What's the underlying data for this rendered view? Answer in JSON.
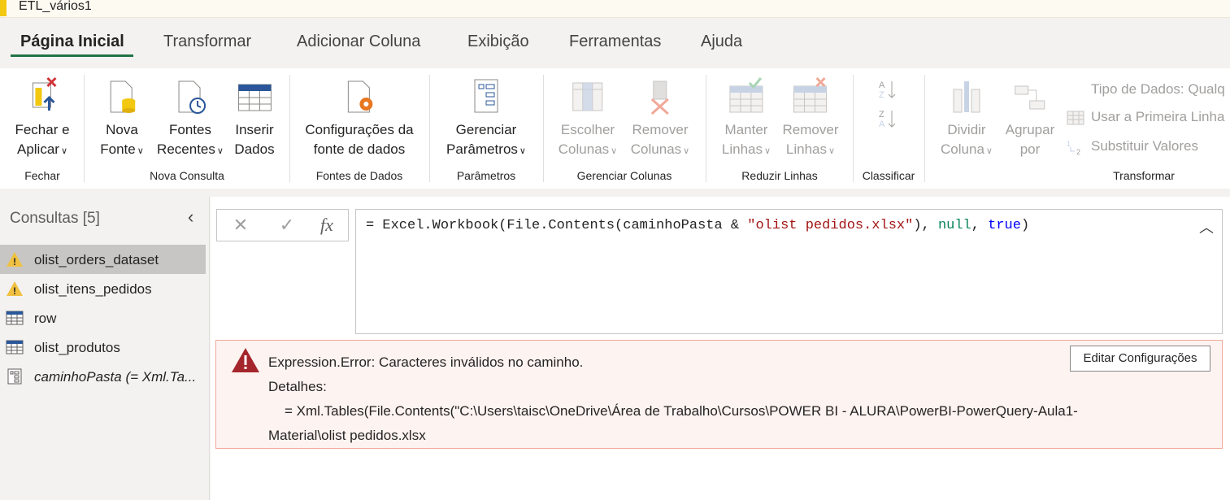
{
  "window": {
    "title": "ETL_vários1"
  },
  "tabs": [
    {
      "label": "Página Inicial",
      "active": true
    },
    {
      "label": "Transformar"
    },
    {
      "label": "Adicionar Coluna"
    },
    {
      "label": "Exibição"
    },
    {
      "label": "Ferramentas"
    },
    {
      "label": "Ajuda"
    }
  ],
  "ribbon": {
    "buttons": {
      "fechar": {
        "l1": "Fechar e",
        "l2": "Aplicar"
      },
      "nova_fonte": {
        "l1": "Nova",
        "l2": "Fonte"
      },
      "fontes_recentes": {
        "l1": "Fontes",
        "l2": "Recentes"
      },
      "inserir_dados": {
        "l1": "Inserir",
        "l2": "Dados"
      },
      "config_fonte": {
        "l1": "Configurações da",
        "l2": "fonte de dados"
      },
      "gerenciar_param": {
        "l1": "Gerenciar",
        "l2": "Parâmetros"
      },
      "escolher_colunas": {
        "l1": "Escolher",
        "l2": "Colunas"
      },
      "remover_colunas": {
        "l1": "Remover",
        "l2": "Colunas"
      },
      "manter_linhas": {
        "l1": "Manter",
        "l2": "Linhas"
      },
      "remover_linhas": {
        "l1": "Remover",
        "l2": "Linhas"
      },
      "dividir_coluna": {
        "l1": "Dividir",
        "l2": "Coluna"
      },
      "agrupar_por": {
        "l1": "Agrupar",
        "l2": "por"
      }
    },
    "small": {
      "tipo_dados": "Tipo de Dados: Qualq",
      "primeira_linha": "Usar a Primeira Linha",
      "substituir": "Substituir Valores"
    },
    "groups": {
      "fechar": "Fechar",
      "nova_consulta": "Nova Consulta",
      "fontes_dados": "Fontes de Dados",
      "parametros": "Parâmetros",
      "gerenciar_colunas": "Gerenciar Colunas",
      "reduzir_linhas": "Reduzir Linhas",
      "classificar": "Classificar",
      "transformar": "Transformar"
    }
  },
  "queries": {
    "title": "Consultas [5]",
    "items": [
      {
        "label": "olist_orders_dataset",
        "icon": "warning-icon"
      },
      {
        "label": "olist_itens_pedidos",
        "icon": "warning-icon"
      },
      {
        "label": "row",
        "icon": "table-icon"
      },
      {
        "label": "olist_produtos",
        "icon": "table-icon"
      },
      {
        "label": "caminhoPasta (= Xml.Ta...",
        "icon": "parameter-icon"
      }
    ]
  },
  "formula": {
    "p1": "= Excel.Workbook(File.Contents(caminhoPasta & ",
    "str": "\"olist pedidos.xlsx\"",
    "p2": "), ",
    "null": "null",
    "p3": ", ",
    "true": "true",
    "p4": ")"
  },
  "error": {
    "message": "Expression.Error: Caracteres inválidos no caminho.",
    "details_label": "Detalhes:",
    "details_line1": "= Xml.Tables(File.Contents(\"C:\\Users\\taisc\\OneDrive\\Área de Trabalho\\Cursos\\POWER BI - ALURA\\PowerBI-PowerQuery-Aula1-",
    "details_line2": "Material\\olist pedidos.xlsx",
    "edit_button": "Editar Configurações"
  },
  "colors": {
    "accent": "#217346",
    "warning": "#f0c040",
    "error": "#a4262c"
  }
}
